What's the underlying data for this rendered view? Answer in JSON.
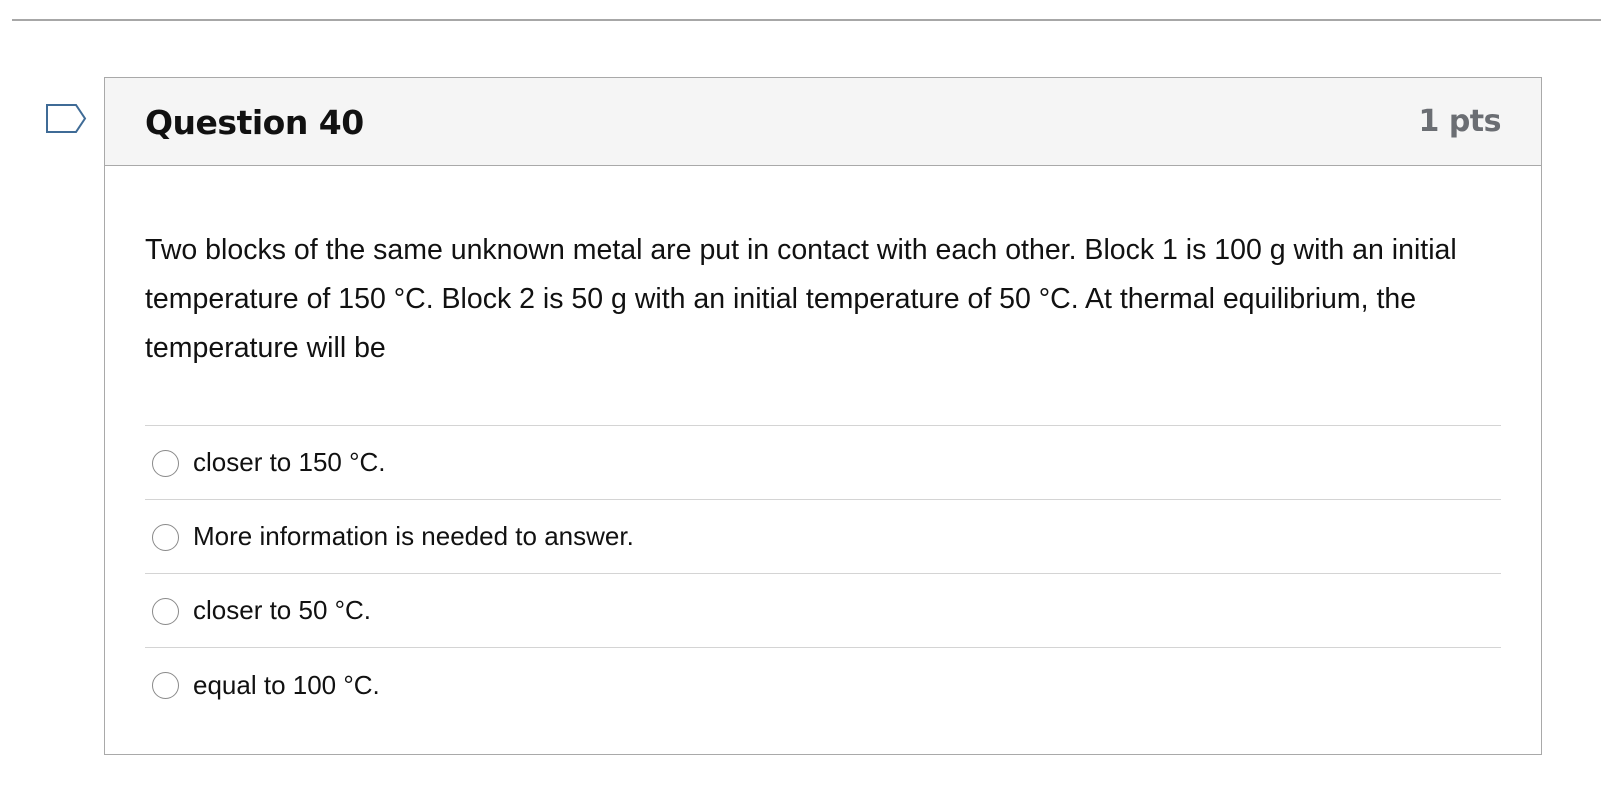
{
  "question": {
    "title": "Question 40",
    "points": "1 pts",
    "flag_icon": "flag-bookmark-icon",
    "text": "Two blocks of the same unknown metal are put in contact with each other. Block 1 is 100 g with an initial temperature of 150 °C. Block 2 is 50 g with an initial temperature of 50 °C. At thermal equilibrium, the temperature will be",
    "answers": [
      {
        "label": "closer to 150 °C.",
        "selected": false
      },
      {
        "label": "More information is needed to answer.",
        "selected": false
      },
      {
        "label": "closer to 50 °C.",
        "selected": false
      },
      {
        "label": "equal to 100 °C.",
        "selected": false
      }
    ]
  },
  "colors": {
    "header_background": "#f5f5f5",
    "border": "#a9a9a9",
    "flag_stroke": "#3f6b96",
    "points_text": "#6b6e73"
  }
}
